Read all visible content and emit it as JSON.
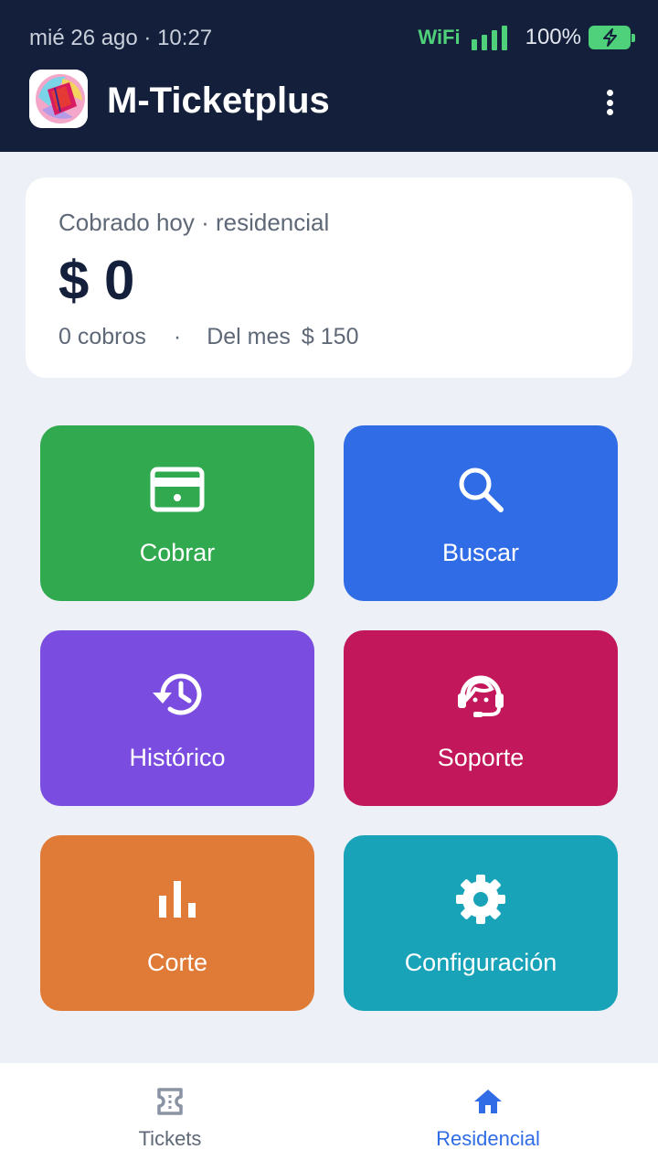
{
  "status_bar": {
    "datetime": "mié 26 ago  ·  10:27",
    "wifi": "WiFi",
    "battery": "100%"
  },
  "app_bar": {
    "title": "M-Ticketplus",
    "logo_icon": "app-logo-icon",
    "menu_icon": "more-vert-icon"
  },
  "summary": {
    "label": "Cobrado hoy · residencial",
    "amount": "$ 0",
    "count": "0 cobros",
    "separator": "·",
    "month_label": "Del mes",
    "month_amount": "$ 150"
  },
  "tiles": [
    {
      "label": "Cobrar",
      "icon": "card-icon",
      "color": "#31a94f"
    },
    {
      "label": "Buscar",
      "icon": "search-icon",
      "color": "#2f6ce6"
    },
    {
      "label": "Histórico",
      "icon": "history-icon",
      "color": "#7a4de0"
    },
    {
      "label": "Soporte",
      "icon": "support-agent-icon",
      "color": "#c2185b"
    },
    {
      "label": "Corte",
      "icon": "bar-chart-icon",
      "color": "#e07b37"
    },
    {
      "label": "Configuración",
      "icon": "gear-icon",
      "color": "#18a3b9"
    }
  ],
  "bottom_nav": {
    "items": [
      {
        "label": "Tickets",
        "icon": "ticket-icon",
        "active": false
      },
      {
        "label": "Residencial",
        "icon": "home-icon",
        "active": true
      }
    ],
    "active_color": "#2f6ce6"
  },
  "colors": {
    "header": "#14203b",
    "background": "#edf1f7",
    "status_green": "#4fd07a"
  }
}
